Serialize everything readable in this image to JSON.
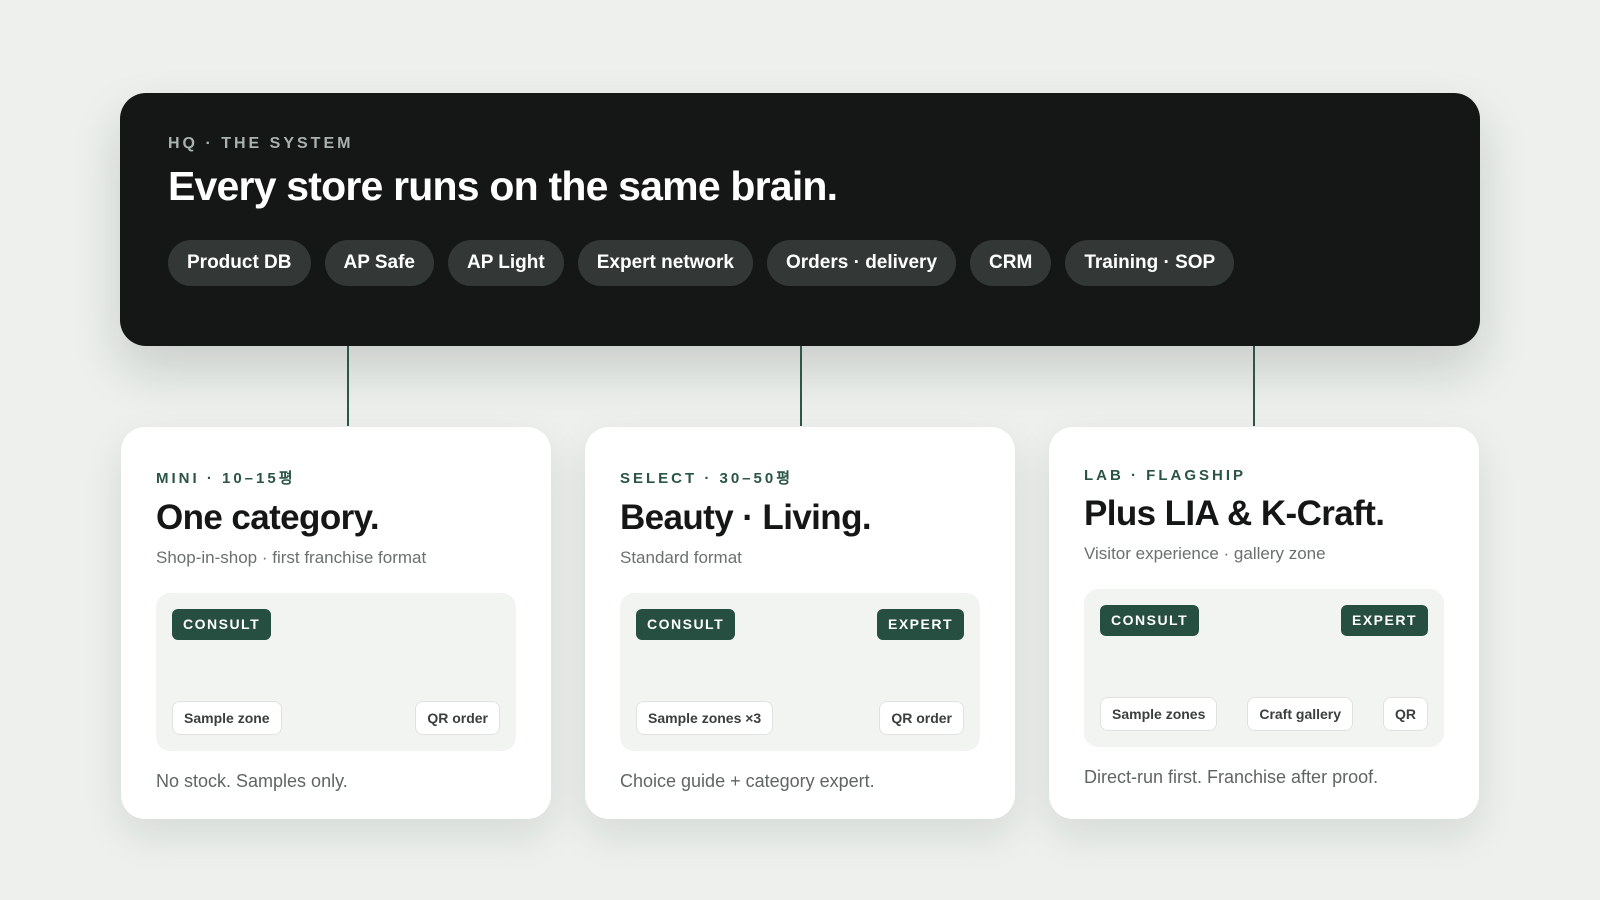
{
  "hq": {
    "eyebrow": "HQ · THE SYSTEM",
    "title": "Every store runs on the same brain.",
    "chips": [
      "Product DB",
      "AP Safe",
      "AP Light",
      "Expert network",
      "Orders · delivery",
      "CRM",
      "Training · SOP"
    ]
  },
  "cards": [
    {
      "eyebrow": "MINI · 10–15평",
      "title": "One category.",
      "subtitle": "Shop-in-shop · first franchise format",
      "badge_left": "CONSULT",
      "badge_right": "",
      "tags": [
        "Sample zone",
        "QR order"
      ],
      "footer": "No stock. Samples only."
    },
    {
      "eyebrow": "SELECT · 30–50평",
      "title": "Beauty · Living.",
      "subtitle": "Standard format",
      "badge_left": "CONSULT",
      "badge_right": "EXPERT",
      "tags": [
        "Sample zones ×3",
        "QR order"
      ],
      "footer": "Choice guide + category expert."
    },
    {
      "eyebrow": "LAB · FLAGSHIP",
      "title": "Plus LIA & K-Craft.",
      "subtitle": "Visitor experience · gallery zone",
      "badge_left": "CONSULT",
      "badge_right": "EXPERT",
      "tags": [
        "Sample zones",
        "Craft gallery",
        "QR"
      ],
      "footer": "Direct-run first. Franchise after proof."
    }
  ],
  "colors": {
    "background": "#edf0ed",
    "hq_panel": "#151716",
    "chip": "#333836",
    "accent_green": "#274f41",
    "card": "#ffffff"
  }
}
